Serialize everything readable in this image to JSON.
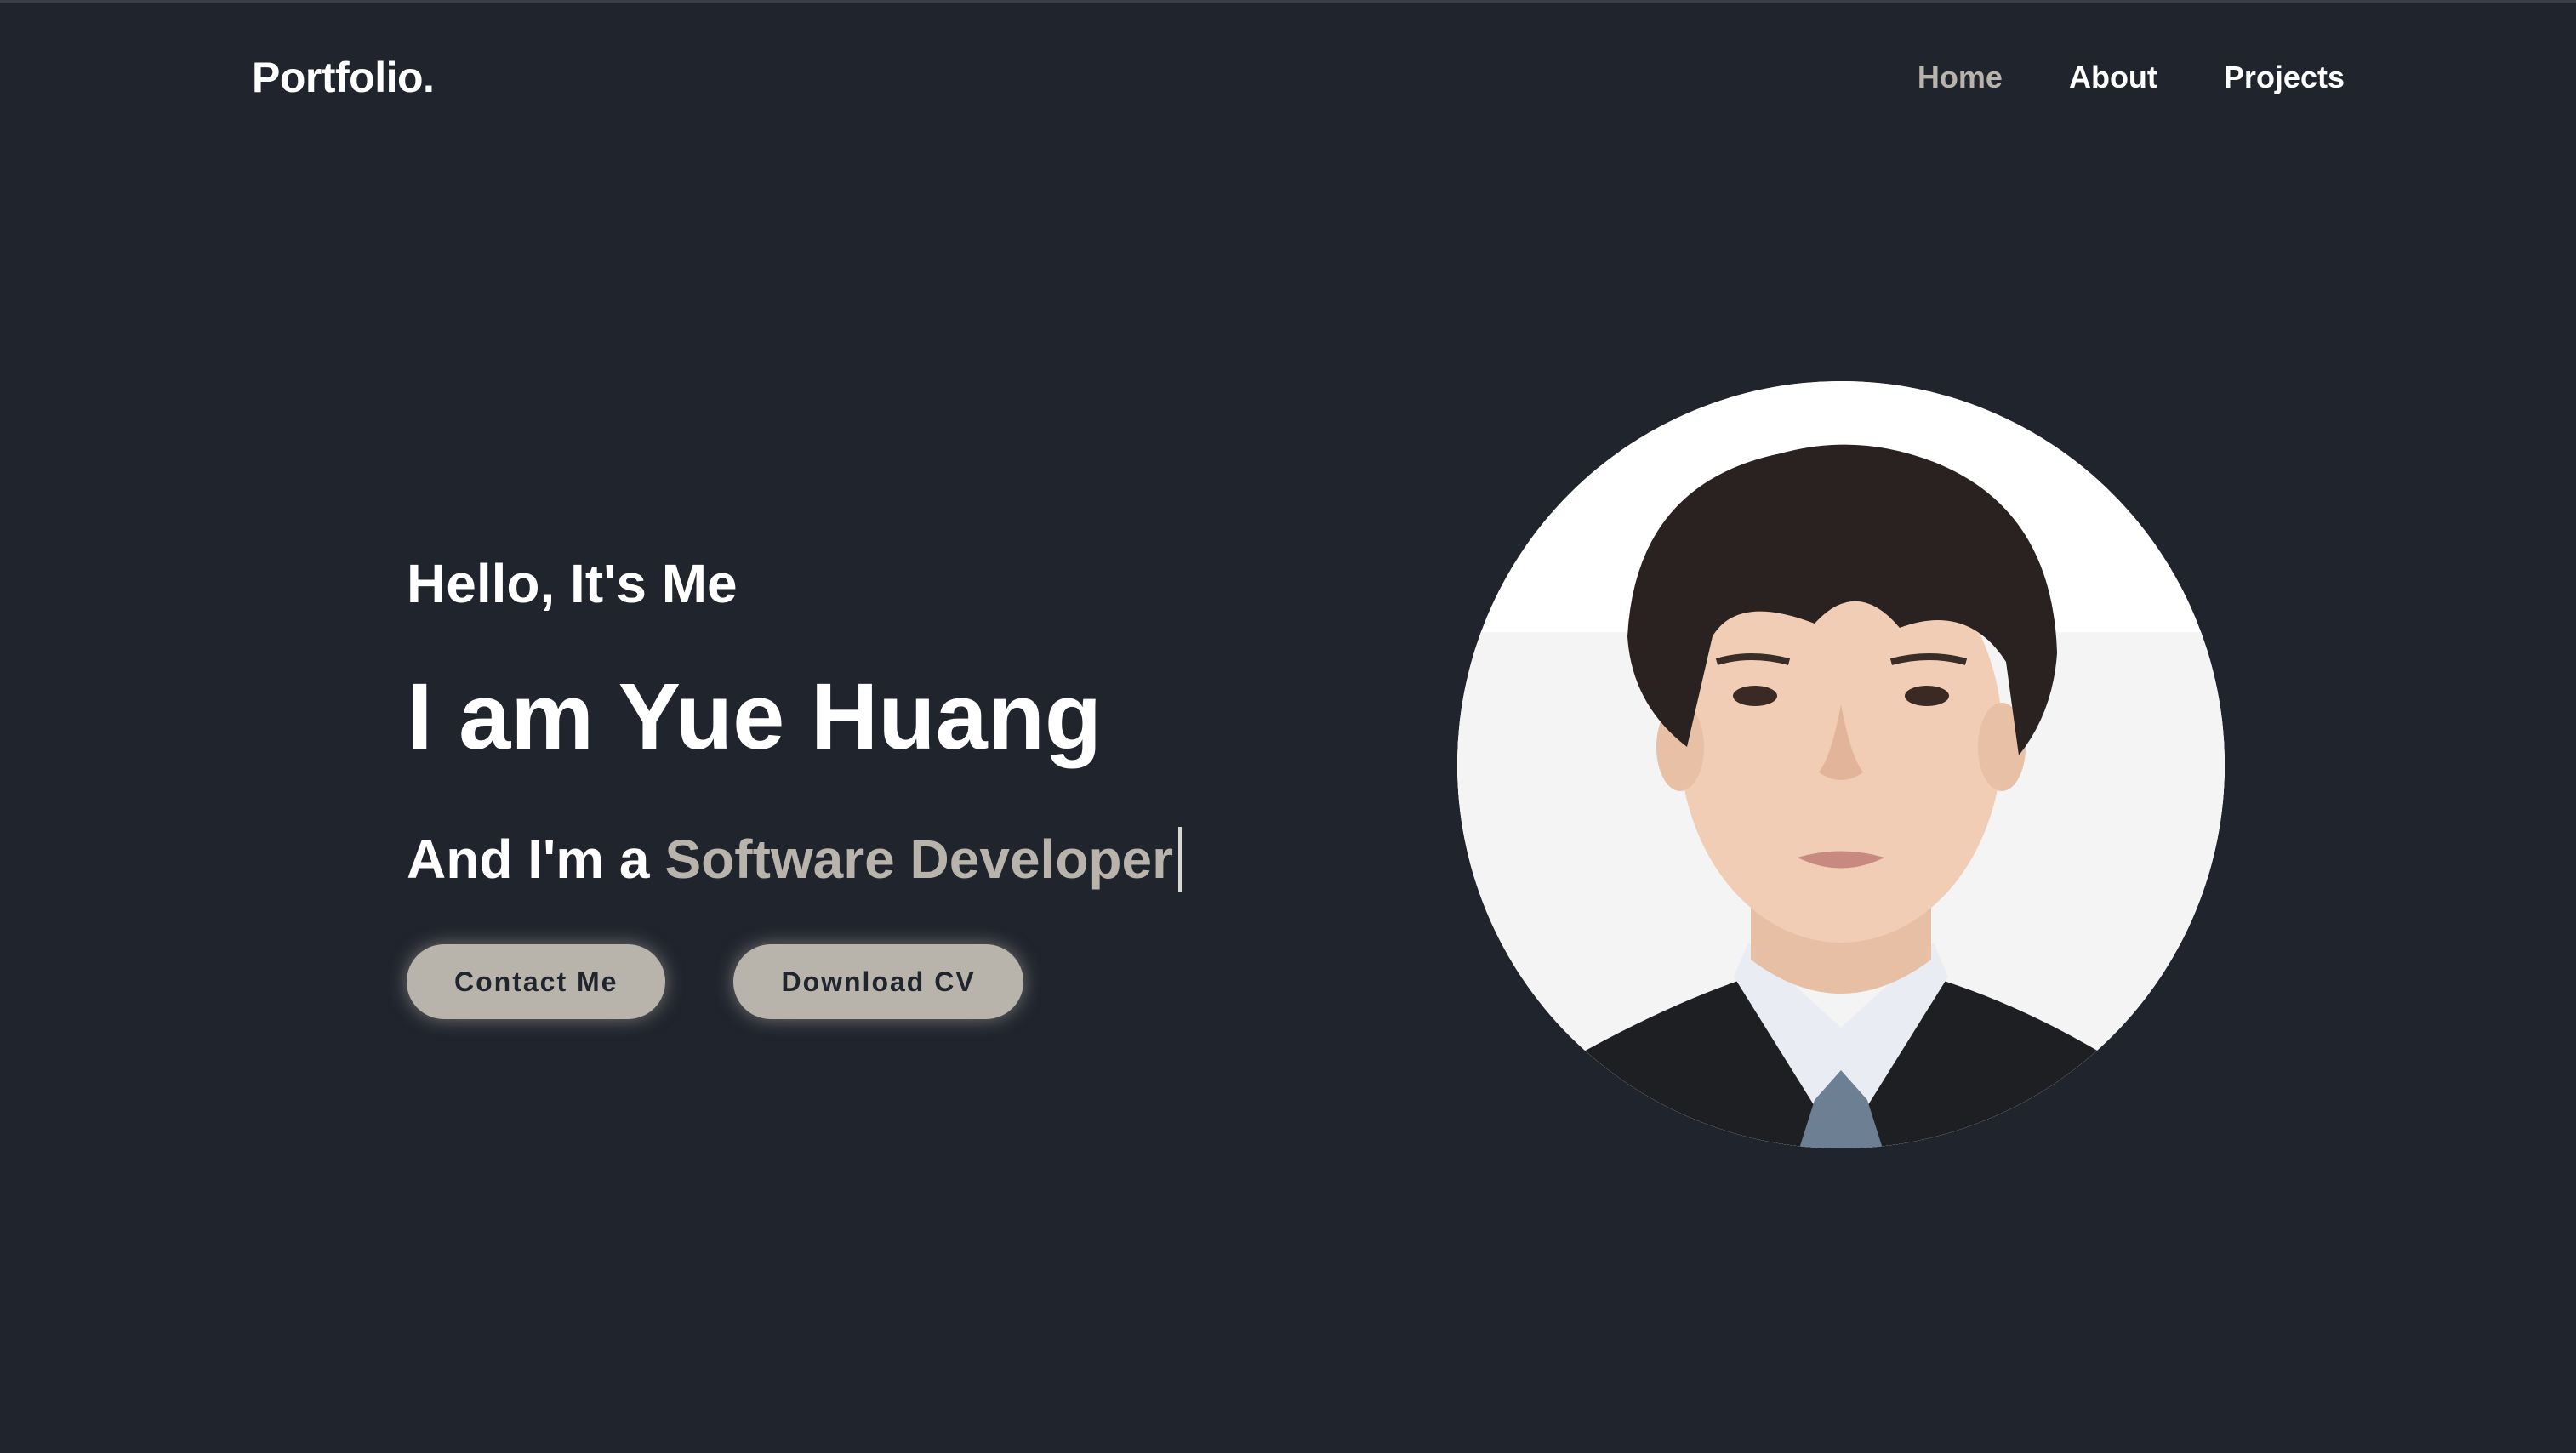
{
  "header": {
    "logo": "Portfolio.",
    "nav": [
      {
        "label": "Home",
        "active": true
      },
      {
        "label": "About",
        "active": false
      },
      {
        "label": "Projects",
        "active": false
      }
    ]
  },
  "hero": {
    "greeting": "Hello, It's Me",
    "name": "I am Yue Huang",
    "role_prefix": "And I'm a",
    "role": "Software Developer",
    "buttons": {
      "contact": "Contact Me",
      "download": "Download CV"
    }
  },
  "colors": {
    "background": "#20242d",
    "accent": "#b9b4ab",
    "text": "#ffffff"
  }
}
